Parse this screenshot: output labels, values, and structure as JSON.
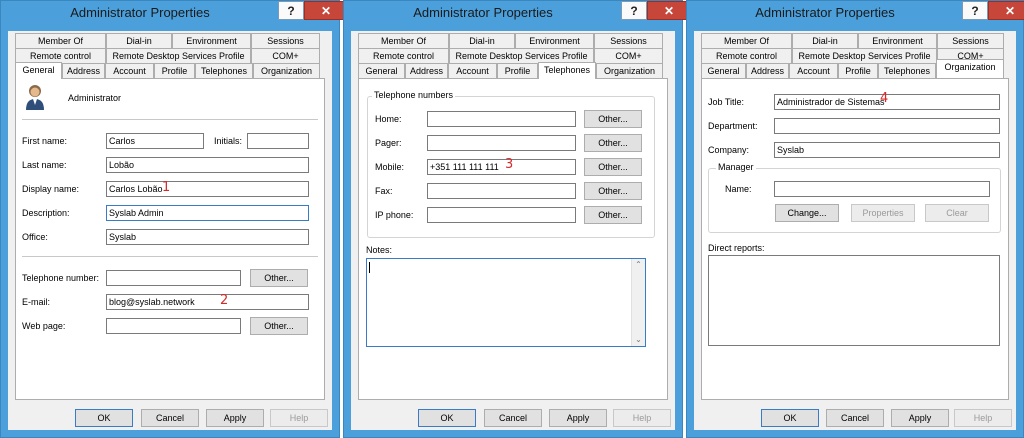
{
  "window_title": "Administrator Properties",
  "titlebar": {
    "help": "?",
    "close": "✕"
  },
  "tabs": {
    "member_of": "Member Of",
    "dial_in": "Dial-in",
    "environment": "Environment",
    "sessions": "Sessions",
    "remote_control": "Remote control",
    "rdsp": "Remote Desktop Services Profile",
    "com_plus": "COM+",
    "general": "General",
    "address": "Address",
    "account": "Account",
    "profile": "Profile",
    "telephones": "Telephones",
    "organization": "Organization"
  },
  "buttons": {
    "ok": "OK",
    "cancel": "Cancel",
    "apply": "Apply",
    "help": "Help",
    "other": "Other..."
  },
  "general": {
    "account_name": "Administrator",
    "first_name_label": "First name:",
    "first_name": "Carlos",
    "initials_label": "Initials:",
    "initials": "",
    "last_name_label": "Last name:",
    "last_name": "Lobão",
    "display_name_label": "Display name:",
    "display_name": "Carlos Lobão",
    "description_label": "Description:",
    "description": "Syslab Admin",
    "office_label": "Office:",
    "office": "Syslab",
    "telephone_label": "Telephone number:",
    "telephone": "",
    "email_label": "E-mail:",
    "email": "blog@syslab.network",
    "webpage_label": "Web page:",
    "webpage": ""
  },
  "telephones": {
    "group_title": "Telephone numbers",
    "home_label": "Home:",
    "home": "",
    "pager_label": "Pager:",
    "pager": "",
    "mobile_label": "Mobile:",
    "mobile": "+351 111 111 111",
    "fax_label": "Fax:",
    "fax": "",
    "ipphone_label": "IP phone:",
    "ipphone": "",
    "notes_label": "Notes:",
    "notes": ""
  },
  "organization": {
    "job_title_label": "Job Title:",
    "job_title": "Administrador de Sistemas",
    "department_label": "Department:",
    "department": "",
    "company_label": "Company:",
    "company": "Syslab",
    "manager_group": "Manager",
    "name_label": "Name:",
    "name": "",
    "change": "Change...",
    "properties": "Properties",
    "clear": "Clear",
    "direct_reports_label": "Direct reports:"
  },
  "annotations": {
    "one": "1",
    "two": "2",
    "three": "3",
    "four": "4"
  },
  "colors": {
    "title_bar": "#4ba0dc",
    "close": "#c7463a",
    "annotation": "#d62a2a"
  }
}
